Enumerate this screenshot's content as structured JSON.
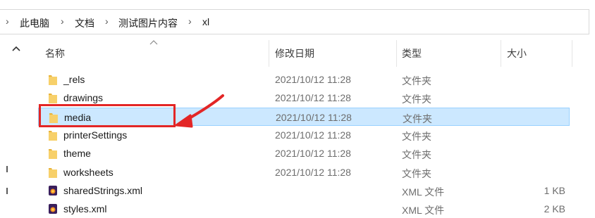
{
  "breadcrumb": {
    "items": [
      "此电脑",
      "文档",
      "测试图片内容",
      "xl"
    ],
    "separator": "›",
    "lead_arrow": "›"
  },
  "columns": {
    "name": "名称",
    "date": "修改日期",
    "type": "类型",
    "size": "大小"
  },
  "files": [
    {
      "name": "_rels",
      "date": "2021/10/12 11:28",
      "type": "文件夹",
      "size": "",
      "icon": "folder-icon"
    },
    {
      "name": "drawings",
      "date": "2021/10/12 11:28",
      "type": "文件夹",
      "size": "",
      "icon": "folder-icon"
    },
    {
      "name": "media",
      "date": "2021/10/12 11:28",
      "type": "文件夹",
      "size": "",
      "icon": "folder-icon",
      "selected": true
    },
    {
      "name": "printerSettings",
      "date": "2021/10/12 11:28",
      "type": "文件夹",
      "size": "",
      "icon": "folder-icon"
    },
    {
      "name": "theme",
      "date": "2021/10/12 11:28",
      "type": "文件夹",
      "size": "",
      "icon": "folder-icon"
    },
    {
      "name": "worksheets",
      "date": "2021/10/12 11:28",
      "type": "文件夹",
      "size": "",
      "icon": "folder-icon"
    },
    {
      "name": "sharedStrings.xml",
      "date": "",
      "type": "XML 文件",
      "size": "1 KB",
      "icon": "xml-file-icon"
    },
    {
      "name": "styles.xml",
      "date": "",
      "type": "XML 文件",
      "size": "2 KB",
      "icon": "xml-file-icon"
    }
  ],
  "colors": {
    "selection_bg": "#cce8ff",
    "selection_border": "#99d1ff",
    "annotation": "#e32626",
    "folder": "#f5c542"
  }
}
